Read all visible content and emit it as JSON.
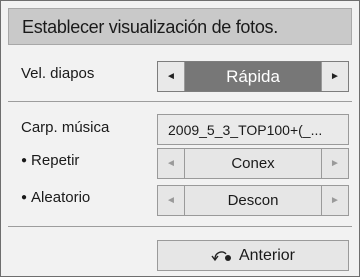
{
  "dialog": {
    "title": "Establecer visualización de fotos.",
    "slide_speed": {
      "label": "Vel. diapos",
      "value": "Rápida"
    },
    "music_folder": {
      "label": "Carp. música",
      "value": "2009_5_3_TOP100+(_..."
    },
    "repeat": {
      "bullet": "●",
      "label": "Repetir",
      "value": "Conex"
    },
    "shuffle": {
      "bullet": "●",
      "label": "Aleatorio",
      "value": "Descon"
    },
    "back_button": {
      "label": "Anterior",
      "icon": "return-icon"
    },
    "arrows": {
      "left": "◄",
      "right": "►"
    }
  }
}
